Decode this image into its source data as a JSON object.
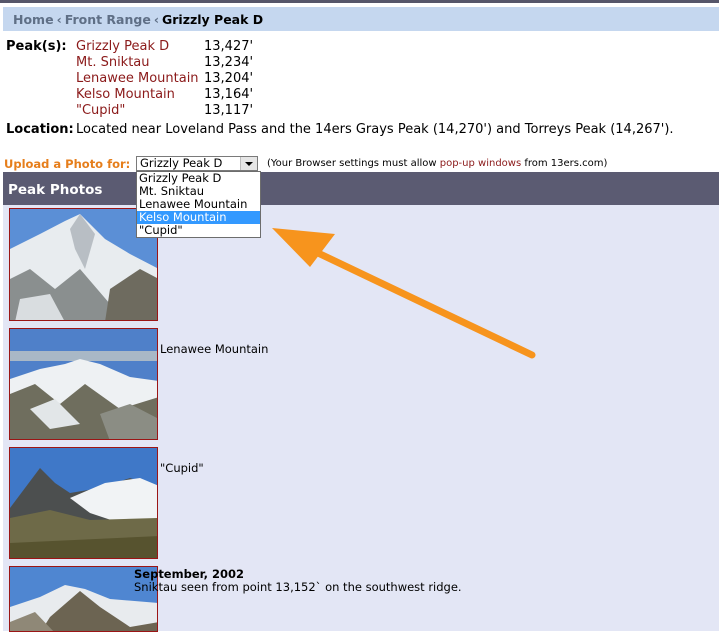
{
  "breadcrumb": {
    "home": "Home",
    "sep": "‹",
    "range": "Front Range",
    "current": "Grizzly Peak D"
  },
  "peaks": {
    "label": "Peak(s):",
    "items": [
      {
        "name": "Grizzly Peak D",
        "elevation": "13,427'"
      },
      {
        "name": "Mt. Sniktau",
        "elevation": "13,234'"
      },
      {
        "name": "Lenawee Mountain",
        "elevation": "13,204'"
      },
      {
        "name": "Kelso Mountain",
        "elevation": "13,164'"
      },
      {
        "name": "\"Cupid\"",
        "elevation": "13,117'"
      }
    ]
  },
  "location": {
    "label": "Location:",
    "text": "Located near Loveland Pass and the 14ers Grays Peak (14,270') and Torreys Peak (14,267')."
  },
  "upload": {
    "label": "Upload a Photo for:",
    "selected": "Grizzly Peak D",
    "options": [
      "Grizzly Peak D",
      "Mt. Sniktau",
      "Lenawee Mountain",
      "Kelso Mountain",
      "\"Cupid\""
    ],
    "highlighted": "Kelso Mountain",
    "note_pre": "(Your Browser settings must allow ",
    "note_link": "pop-up windows",
    "note_post": " from 13ers.com)"
  },
  "photos": {
    "header": "Peak Photos",
    "captions": [
      "Lenawee Mountain",
      "\"Cupid\""
    ],
    "last_date": "September, 2002",
    "last_text": "Sniktau seen from point 13,152` on the southwest ridge."
  },
  "colors": {
    "link": "#8b1a1a",
    "accent": "#e67e1b",
    "header_bg": "#5b5b72",
    "breadcrumb_bg": "#c5d7ef",
    "arrow": "#f7941d"
  }
}
